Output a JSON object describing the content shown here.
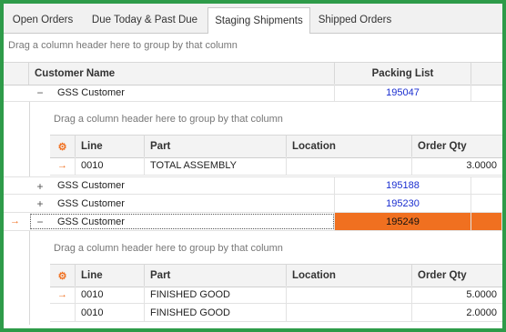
{
  "tabs": [
    {
      "label": "Open Orders",
      "active": false
    },
    {
      "label": "Due Today & Past Due",
      "active": false
    },
    {
      "label": "Staging Shipments",
      "active": true
    },
    {
      "label": "Shipped Orders",
      "active": false
    }
  ],
  "group_hint": "Drag a column header here to group by that column",
  "main_grid": {
    "columns": [
      "Customer Name",
      "Packing List"
    ],
    "rows": [
      {
        "customer": "GSS Customer",
        "packing_list": "195047",
        "expanded": true
      },
      {
        "customer": "GSS Customer",
        "packing_list": "195188",
        "expanded": false
      },
      {
        "customer": "GSS Customer",
        "packing_list": "195230",
        "expanded": false
      },
      {
        "customer": "GSS Customer",
        "packing_list": "195249",
        "expanded": true,
        "selected": true
      }
    ]
  },
  "detail_grids": [
    {
      "group_hint": "Drag a column header here to group by that column",
      "columns": [
        "Line",
        "Part",
        "Location",
        "Order Qty"
      ],
      "rows": [
        {
          "line": "0010",
          "part": "TOTAL ASSEMBLY",
          "location": "",
          "order_qty": "3.0000"
        }
      ]
    },
    {
      "group_hint": "Drag a column header here to group by that column",
      "columns": [
        "Line",
        "Part",
        "Location",
        "Order Qty"
      ],
      "rows": [
        {
          "line": "0010",
          "part": "FINISHED GOOD",
          "location": "",
          "order_qty": "5.0000"
        },
        {
          "line": "0010",
          "part": "FINISHED GOOD",
          "location": "",
          "order_qty": "2.0000"
        }
      ]
    }
  ],
  "icons": {
    "expanded": "minus-icon",
    "collapsed": "plus-icon",
    "row_indicator": "arrow-right-icon",
    "column_chooser": "column-chooser-icon"
  },
  "colors": {
    "frame": "#2e9b49",
    "selection": "#f07020",
    "link": "#1a2ed0"
  }
}
